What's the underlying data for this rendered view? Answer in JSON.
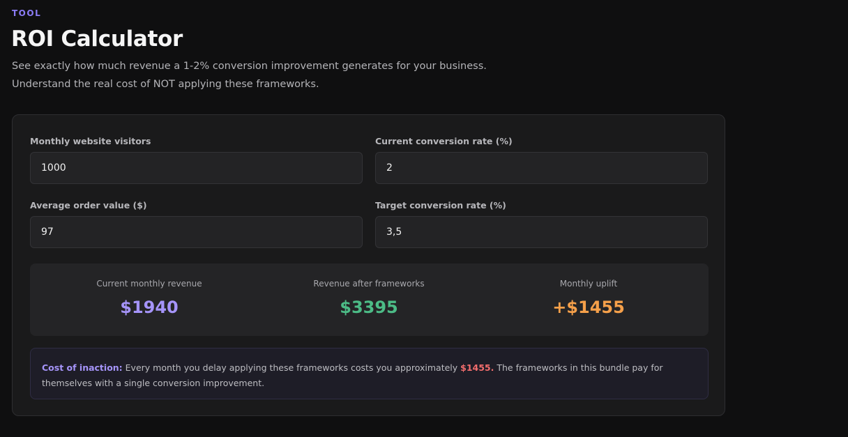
{
  "header": {
    "eyebrow": "TOOL",
    "title": "ROI Calculator",
    "subtitle_line1": "See exactly how much revenue a 1-2% conversion improvement generates for your business.",
    "subtitle_line2": "Understand the real cost of NOT applying these frameworks."
  },
  "form": {
    "monthly_visitors": {
      "label": "Monthly website visitors",
      "value": "1000"
    },
    "current_conversion": {
      "label": "Current conversion rate (%)",
      "value": "2"
    },
    "order_value": {
      "label": "Average order value ($)",
      "value": "97"
    },
    "target_conversion": {
      "label": "Target conversion rate (%)",
      "value": "3,5"
    }
  },
  "results": {
    "current_revenue": {
      "label": "Current monthly revenue",
      "value": "$1940",
      "color": "#a594f9"
    },
    "revenue_after": {
      "label": "Revenue after frameworks",
      "value": "$3395",
      "color": "#4cbb86"
    },
    "monthly_uplift": {
      "label": "Monthly uplift",
      "value": "+$1455",
      "color": "#f5a04a"
    }
  },
  "notice": {
    "lead": "Cost of inaction:",
    "text_before": " Every month you delay applying these frameworks costs you approximately ",
    "amount": "$1455.",
    "text_after": " The frameworks in this bundle pay for themselves with a single conversion improvement."
  },
  "colors": {
    "accent": "#8b7cf6",
    "background": "#0f0f10",
    "card": "#1a1a1b",
    "negative": "#f26d6d"
  }
}
